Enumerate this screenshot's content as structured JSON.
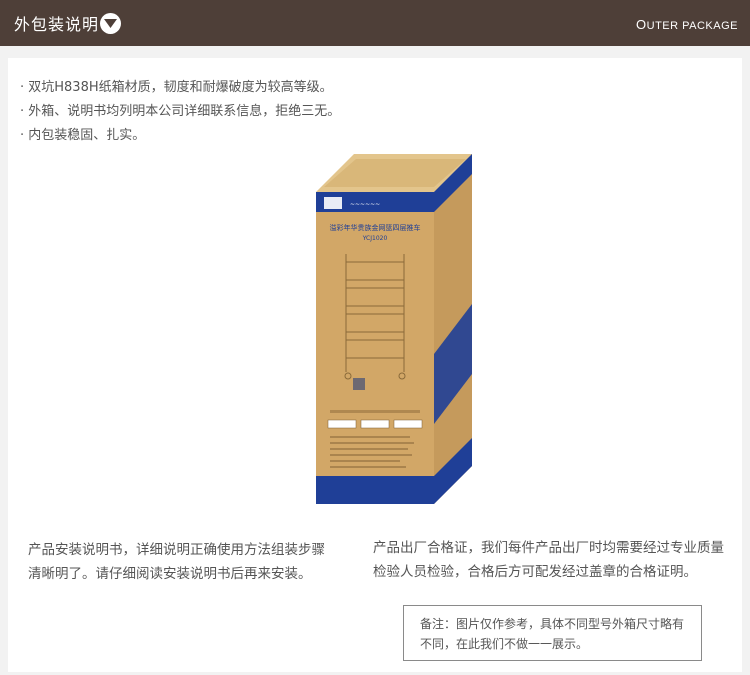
{
  "header": {
    "title": "外包装说明",
    "subtitle_en_cap": "O",
    "subtitle_en_rest": "UTER PACKAGE"
  },
  "bullets": [
    "· 双坑H838H纸箱材质，韧度和耐爆破度为较高等级。",
    "· 外箱、说明书均列明本公司详细联系信息，拒绝三无。",
    "· 内包装稳固、扎实。"
  ],
  "box": {
    "product_name": "溢彩年华贵族金网篮四层推车",
    "model": "YCJ1020"
  },
  "descriptions": {
    "left": "产品安装说明书，详细说明正确使用方法组装步骤清晰明了。请仔细阅读安装说明书后再来安装。",
    "right": "产品出厂合格证，我们每件产品出厂时均需要经过专业质量检验人员检验，合格后方可配发经过盖章的合格证明。"
  },
  "note": "备注：图片仅作参考，具体不同型号外箱尺寸略有不同，在此我们不做一一展示。",
  "colors": {
    "header_bg": "#4e3f38",
    "box_blue": "#1f3f97",
    "box_kraft": "#d2a767"
  },
  "icons": {
    "header_toggle": "chevron-down-circle-icon"
  }
}
